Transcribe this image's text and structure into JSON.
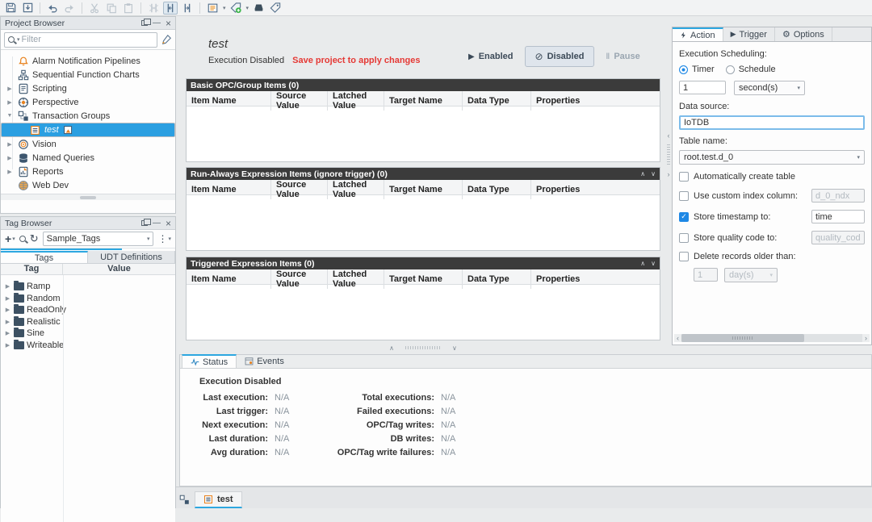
{
  "glyphs": {
    "expand_collapsed": "▶",
    "expand_expanded": "▼",
    "chevron_up": "∧",
    "chevron_down": "∨",
    "left_arrow": "‹",
    "right_arrow": "›",
    "minimize": "—",
    "close": "×",
    "kebab": "⋮",
    "dropdown": "▾",
    "play": "▶",
    "pause": "Ⅱ",
    "ban": "⊘",
    "bolt": "⚡",
    "gear": "⚙",
    "check": "✓",
    "plus": "+",
    "refresh": "↻"
  },
  "project_browser": {
    "title": "Project Browser",
    "filter_placeholder": "Filter",
    "items": [
      {
        "label": "Alarm Notification Pipelines"
      },
      {
        "label": "Sequential Function Charts"
      },
      {
        "label": "Scripting"
      },
      {
        "label": "Perspective"
      },
      {
        "label": "Transaction Groups"
      },
      {
        "label": "test"
      },
      {
        "label": "Vision"
      },
      {
        "label": "Named Queries"
      },
      {
        "label": "Reports"
      },
      {
        "label": "Web Dev"
      }
    ]
  },
  "tag_browser": {
    "title": "Tag Browser",
    "provider": "Sample_Tags",
    "tabs": {
      "tags": "Tags",
      "udt": "UDT Definitions"
    },
    "columns": {
      "tag": "Tag",
      "value": "Value"
    },
    "folders": [
      {
        "label": "Ramp"
      },
      {
        "label": "Random"
      },
      {
        "label": "ReadOnly"
      },
      {
        "label": "Realistic"
      },
      {
        "label": "Sine"
      },
      {
        "label": "Writeable"
      }
    ]
  },
  "group": {
    "title": "test",
    "status": "Execution Disabled",
    "warning": "Save project to apply changes",
    "buttons": {
      "enabled": "Enabled",
      "disabled": "Disabled",
      "pause": "Pause"
    },
    "columns": [
      "Item Name",
      "Source Value",
      "Latched Value",
      "Target Name",
      "Data Type",
      "Properties"
    ],
    "tables": [
      {
        "title": "Basic OPC/Group Items (0)"
      },
      {
        "title": "Run-Always Expression Items (ignore trigger) (0)"
      },
      {
        "title": "Triggered Expression Items (0)"
      }
    ]
  },
  "status_panel": {
    "tabs": {
      "status": "Status",
      "events": "Events"
    },
    "heading": "Execution Disabled",
    "left": [
      {
        "label": "Last execution:",
        "value": "N/A"
      },
      {
        "label": "Last trigger:",
        "value": "N/A"
      },
      {
        "label": "Next execution:",
        "value": "N/A"
      },
      {
        "label": "Last duration:",
        "value": "N/A"
      },
      {
        "label": "Avg duration:",
        "value": "N/A"
      }
    ],
    "right": [
      {
        "label": "Total executions:",
        "value": "N/A"
      },
      {
        "label": "Failed executions:",
        "value": "N/A"
      },
      {
        "label": "OPC/Tag writes:",
        "value": "N/A"
      },
      {
        "label": "DB writes:",
        "value": "N/A"
      },
      {
        "label": "OPC/Tag write failures:",
        "value": "N/A"
      }
    ]
  },
  "action_panel": {
    "tabs": {
      "action": "Action",
      "trigger": "Trigger",
      "options": "Options"
    },
    "scheduling_label": "Execution Scheduling:",
    "timer_label": "Timer",
    "schedule_label": "Schedule",
    "timer_value": "1",
    "timer_unit": "second(s)",
    "data_source_label": "Data source:",
    "data_source_value": "IoTDB",
    "table_name_label": "Table name:",
    "table_name_value": "root.test.d_0",
    "auto_create_label": "Automatically create table",
    "custom_index_label": "Use custom index column:",
    "custom_index_value": "d_0_ndx",
    "store_ts_label": "Store timestamp to:",
    "store_ts_value": "time",
    "store_quality_label": "Store quality code to:",
    "store_quality_value": "quality_code",
    "delete_older_label": "Delete records older than:",
    "delete_value": "1",
    "delete_unit": "day(s)"
  },
  "bottom_bar": {
    "tab_label": "test"
  },
  "colors": {
    "accent": "#2da7e0",
    "selection": "#2b9fe1",
    "warning": "#e53935",
    "table_header": "#3b3b3b"
  }
}
